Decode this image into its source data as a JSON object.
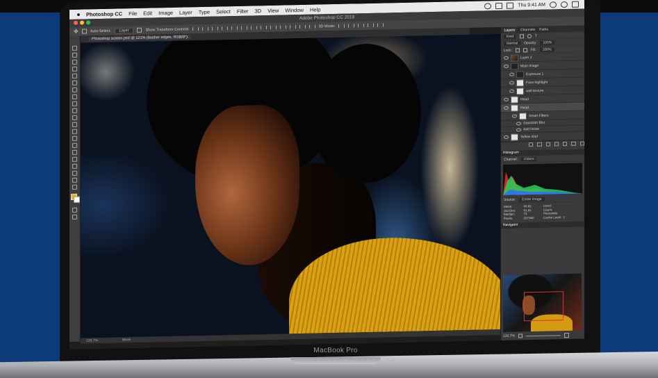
{
  "laptop": {
    "model": "MacBook Pro"
  },
  "menubar": {
    "app_name": "Photoshop CC",
    "items": [
      "File",
      "Edit",
      "Image",
      "Layer",
      "Type",
      "Select",
      "Filter",
      "3D",
      "View",
      "Window",
      "Help"
    ],
    "clock": "Thu 9:41 AM"
  },
  "window": {
    "title": "Adobe Photoshop CC 2018"
  },
  "options_bar": {
    "auto_select_label": "Auto-Select:",
    "auto_select_value": "Layer",
    "transform_controls_label": "Show Transform Controls",
    "mode_3d": "3D Mode:"
  },
  "document": {
    "tab_title": "Photoshop screen.psd @ 121% (feather edges, RGB/8*)"
  },
  "status_bar": {
    "zoom": "120.7%",
    "info": "Move"
  },
  "layers_panel": {
    "tabs": [
      "Layers",
      "Channels",
      "Paths"
    ],
    "kind_filter": "Kind",
    "blend_mode": "Normal",
    "opacity_label": "Opacity:",
    "opacity_value": "100%",
    "lock_label": "Lock:",
    "fill_label": "Fill:",
    "fill_value": "100%",
    "layers": [
      {
        "name": "Layer 2"
      },
      {
        "name": "Main Image"
      },
      {
        "name": "Exposure 1"
      },
      {
        "name": "Face highlight"
      },
      {
        "name": "wall texture"
      },
      {
        "name": "Head"
      },
      {
        "name": "Head"
      },
      {
        "name": "Smart Filters"
      },
      {
        "name": "Gaussian Blur"
      },
      {
        "name": "Add Noise"
      },
      {
        "name": "Yellow shirt"
      }
    ]
  },
  "histogram": {
    "title": "Histogram",
    "channel_label": "Channel:",
    "channel_value": "Colors",
    "source_label": "Source:",
    "source_value": "Entire Image",
    "stats": [
      {
        "label": "Mean:",
        "value": "84.62"
      },
      {
        "label": "Level:",
        "value": ""
      },
      {
        "label": "Std Dev:",
        "value": "61.81"
      },
      {
        "label": "Count:",
        "value": ""
      },
      {
        "label": "Median:",
        "value": "74"
      },
      {
        "label": "Percentile:",
        "value": ""
      },
      {
        "label": "Pixels:",
        "value": "207360"
      },
      {
        "label": "Cache Level:",
        "value": "1"
      }
    ]
  },
  "navigator": {
    "title": "Navigator",
    "zoom": "120.7%"
  },
  "colors": {
    "foreground": "#e0b32a",
    "histo_red": "#ff2b2b",
    "histo_green": "#24d05a",
    "histo_blue": "#2f6dff"
  }
}
